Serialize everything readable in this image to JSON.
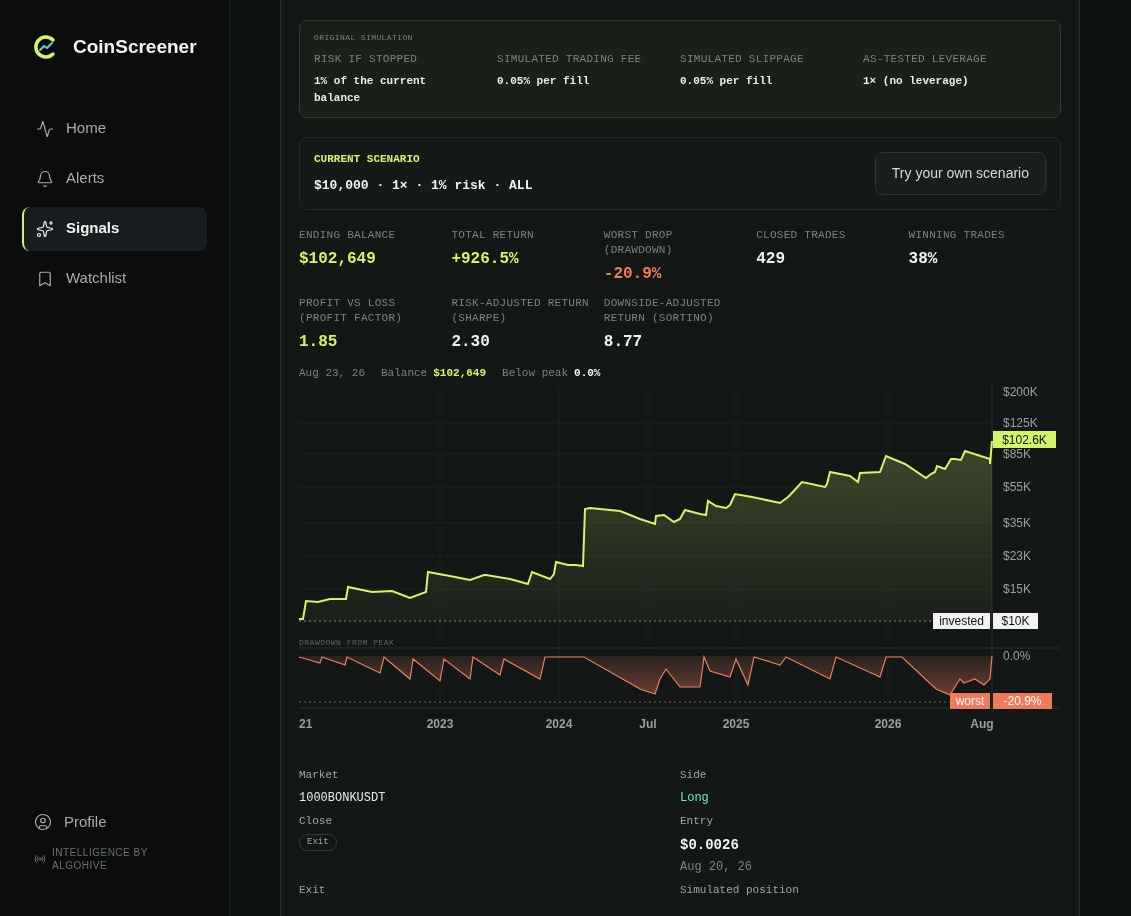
{
  "sidebar": {
    "brand": "CoinScreener",
    "nav": [
      {
        "label": "Home",
        "selected": false
      },
      {
        "label": "Alerts",
        "selected": false
      },
      {
        "label": "Signals",
        "selected": true
      },
      {
        "label": "Watchlist",
        "selected": false
      }
    ],
    "profile": "Profile",
    "credit": "INTELLIGENCE BY ALGOHIVE"
  },
  "simulation": {
    "title": "ORIGINAL SIMULATION",
    "fields": [
      {
        "label": "RISK IF STOPPED",
        "value": "1% of the current balance"
      },
      {
        "label": "SIMULATED TRADING FEE",
        "value": "0.05% per fill"
      },
      {
        "label": "SIMULATED SLIPPAGE",
        "value": "0.05% per fill"
      },
      {
        "label": "AS-TESTED LEVERAGE",
        "value": "1× (no leverage)"
      }
    ]
  },
  "scenario": {
    "title": "CURRENT SCENARIO",
    "value": "$10,000 · 1× · 1% risk · ALL",
    "button": "Try your own scenario"
  },
  "metrics": [
    {
      "label": "ENDING BALANCE",
      "value": "$102,649",
      "kind": "positive"
    },
    {
      "label": "TOTAL RETURN",
      "value": "+926.5%",
      "kind": "positive"
    },
    {
      "label": "WORST DROP (DRAWDOWN)",
      "value": "-20.9%",
      "kind": "negative"
    },
    {
      "label": "CLOSED TRADES",
      "value": "429",
      "kind": "neutral"
    },
    {
      "label": "WINNING TRADES",
      "value": "38%",
      "kind": "neutral"
    },
    {
      "label": "PROFIT VS LOSS (PROFIT FACTOR)",
      "value": "1.85",
      "kind": "positive"
    },
    {
      "label": "RISK-ADJUSTED RETURN (SHARPE)",
      "value": "2.30",
      "kind": "neutral"
    },
    {
      "label": "DOWNSIDE-ADJUSTED RETURN (SORTINO)",
      "value": "8.77",
      "kind": "neutral"
    }
  ],
  "readout": {
    "date": "Aug 23, 26",
    "balance_label": "Balance",
    "balance_value": "$102,649",
    "below_label": "Below peak",
    "below_value": "0.0%"
  },
  "chart": {
    "y_ticks": [
      "$200K",
      "$125K",
      "$85K",
      "$55K",
      "$35K",
      "$23K",
      "$15K"
    ],
    "current_badge": "$102.6K",
    "invested_label": "invested",
    "invested_value": "$10K",
    "drawdown_title": "DRAWDOWN FROM PEAK",
    "drawdown_zero": "0.0%",
    "worst_label": "worst",
    "worst_value": "-20.9%",
    "x_labels": [
      "21",
      "2023",
      "2024",
      "Jul",
      "2025",
      "2026",
      "Aug"
    ]
  },
  "details": [
    {
      "label": "Market",
      "value": "1000BONKUSDT",
      "kind": "text"
    },
    {
      "label": "Side",
      "value": "Long",
      "kind": "side"
    },
    {
      "label": "Close",
      "value": "Exit",
      "kind": "pill"
    },
    {
      "label": "Entry",
      "value": "$0.0026",
      "kind": "price",
      "sub": "Aug 20, 26"
    },
    {
      "label": "Exit",
      "kind": "label"
    },
    {
      "label": "Simulated position",
      "kind": "label"
    }
  ]
}
